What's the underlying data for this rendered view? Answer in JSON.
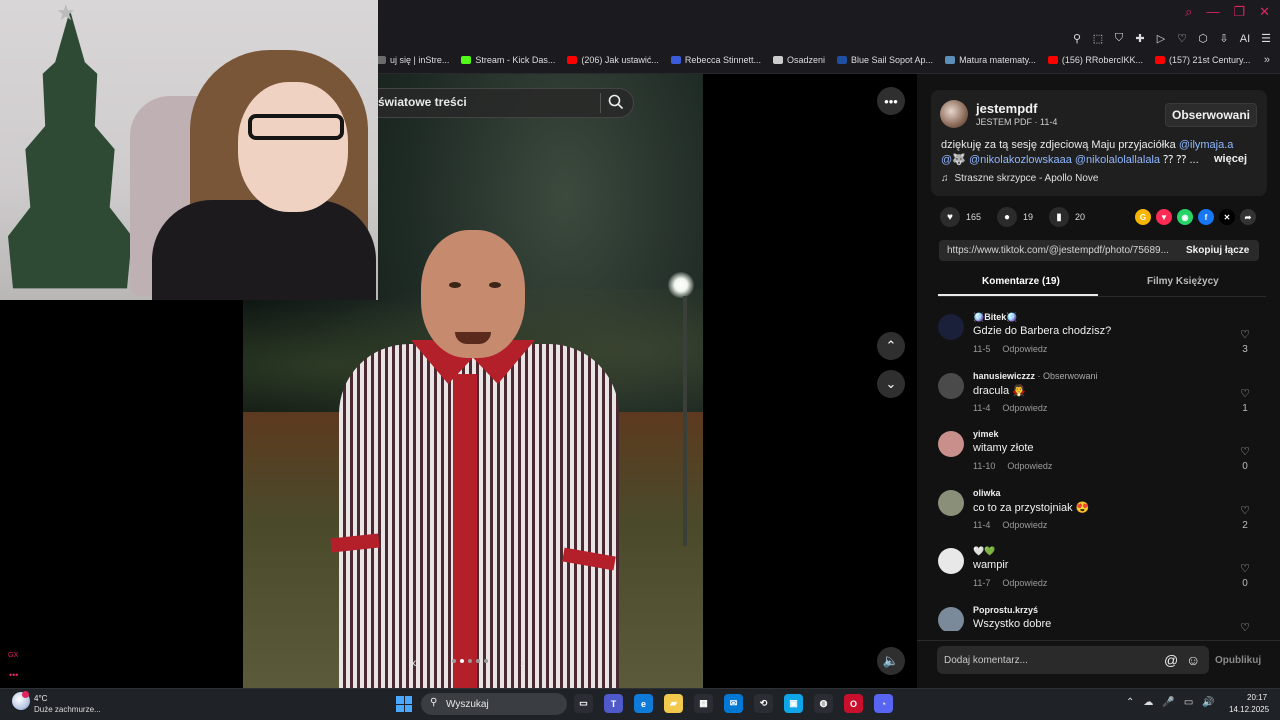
{
  "browser": {
    "window_controls": [
      "⌕",
      "—",
      "❐",
      "✕"
    ],
    "extension_icons": [
      "⚲",
      "⬚",
      "⛉",
      "✚",
      "▷",
      "♡",
      "⬡",
      "⇩",
      "AI",
      "☰"
    ],
    "bookmarks": [
      {
        "label": "uj się | inStre...",
        "color": "#6b6b6b"
      },
      {
        "label": "Stream - Kick Das...",
        "color": "#53fc18"
      },
      {
        "label": "(206) Jak ustawić...",
        "color": "#ff0000"
      },
      {
        "label": "Rebecca Stinnett...",
        "color": "#3b5bdb"
      },
      {
        "label": "Osadzeni",
        "color": "#cccccc"
      },
      {
        "label": "Blue Sail Sopot Ap...",
        "color": "#1f4fa0"
      },
      {
        "label": "Matura matematy...",
        "color": "#5b8fb9"
      },
      {
        "label": "(156) RRobercIKK...",
        "color": "#ff0000"
      },
      {
        "label": "(157) 21st Century...",
        "color": "#ff0000"
      }
    ],
    "bookmarks_more": "»"
  },
  "viewer": {
    "search_text": "światowe treści",
    "more_label": "•••",
    "up_label": "⌃",
    "down_label": "⌄",
    "mute_label": "🔈",
    "prev_label": "‹",
    "next_label": "›",
    "photo_count": 5,
    "photo_active_index": 1
  },
  "edge_marks": {
    "gx": "GX",
    "dots": "•••"
  },
  "post": {
    "author": "jestempdf",
    "author_sub": "JESTEM PDF · 11-4",
    "follow_label": "Obserwowani",
    "caption_line1_text": "dziękuję za tą sesję zdjeciową Maju przyjaciółka",
    "caption_line1_mention": "@ilymaja.a",
    "caption_line2_pre": "@🐺",
    "caption_line2_mentions": "@nikolakozlowskaaa @nikolalolallalala",
    "caption_line2_post": "⁇ ⁇ ...",
    "more_label": "więcej",
    "music_icon": "♫",
    "music": "Straszne skrzypce - Apollo Nove"
  },
  "stats": {
    "likes": "165",
    "comments": "19",
    "saves": "20",
    "share_colors": [
      "#f7b500",
      "#fe2c55",
      "#25d366",
      "#1877f2",
      "#000000",
      "#333333"
    ],
    "share_labels": [
      "G",
      "▼",
      "◉",
      "f",
      "✕",
      "➦"
    ]
  },
  "link": {
    "url": "https://www.tiktok.com/@jestempdf/photo/75689...",
    "copy_label": "Skopiuj łącze"
  },
  "tabs": {
    "comments": "Komentarze (19)",
    "videos": "Filmy Księżycy"
  },
  "comments": [
    {
      "user": "🪩Bitek🪩",
      "tag": "",
      "text": "Gdzie do Barbera chodzisz?",
      "date": "11-5",
      "reply": "Odpowiedz",
      "likes": "3",
      "avatar_color": "#1a1f3a"
    },
    {
      "user": "hanusiewiczzz",
      "tag": " · Obserwowani",
      "text": "dracula 🧛",
      "date": "11-4",
      "reply": "Odpowiedz",
      "likes": "1",
      "avatar_color": "#4a4a4a"
    },
    {
      "user": "yimek",
      "tag": "",
      "text": "witamy złote",
      "date": "11-10",
      "reply": "Odpowiedz",
      "likes": "0",
      "avatar_color": "#c98f8a"
    },
    {
      "user": "oliwka",
      "tag": "",
      "text": "co to za przystojniak 😍",
      "date": "11-4",
      "reply": "Odpowiedz",
      "likes": "2",
      "avatar_color": "#8a8f7a"
    },
    {
      "user": "🤍💚",
      "tag": "",
      "text": "wampir",
      "date": "11-7",
      "reply": "Odpowiedz",
      "likes": "0",
      "avatar_color": "#e8e8e8"
    },
    {
      "user": "Poprostu.krzyś",
      "tag": "",
      "text": "Wszystko dobre",
      "date": "",
      "reply": "",
      "likes": "",
      "avatar_color": "#7a8a9a"
    }
  ],
  "comment_bar": {
    "placeholder": "Dodaj komentarz...",
    "at_icon": "@",
    "emoji_icon": "☺",
    "publish": "Opublikuj"
  },
  "taskbar": {
    "weather_temp": "4°C",
    "weather_desc": "Duże zachmurze...",
    "search_label": "Wyszukaj",
    "apps": [
      {
        "label": "▭",
        "color": "#2a2d33"
      },
      {
        "label": "T",
        "color": "#5059c9"
      },
      {
        "label": "e",
        "color": "#0f7bd8"
      },
      {
        "label": "▰",
        "color": "#f2c94c"
      },
      {
        "label": "▦",
        "color": "#2a2d33"
      },
      {
        "label": "✉",
        "color": "#0078d4"
      },
      {
        "label": "⟲",
        "color": "#2a2d33"
      },
      {
        "label": "▣",
        "color": "#0ea5e9"
      },
      {
        "label": "◍",
        "color": "#2a2d33"
      },
      {
        "label": "O",
        "color": "#c8102e"
      },
      {
        "label": "◔",
        "color": "#5865f2"
      }
    ],
    "tray": [
      "⌃",
      "☁",
      "🎤",
      "▭",
      "🔊"
    ],
    "time": "20:17",
    "date": "14.12.2025"
  }
}
